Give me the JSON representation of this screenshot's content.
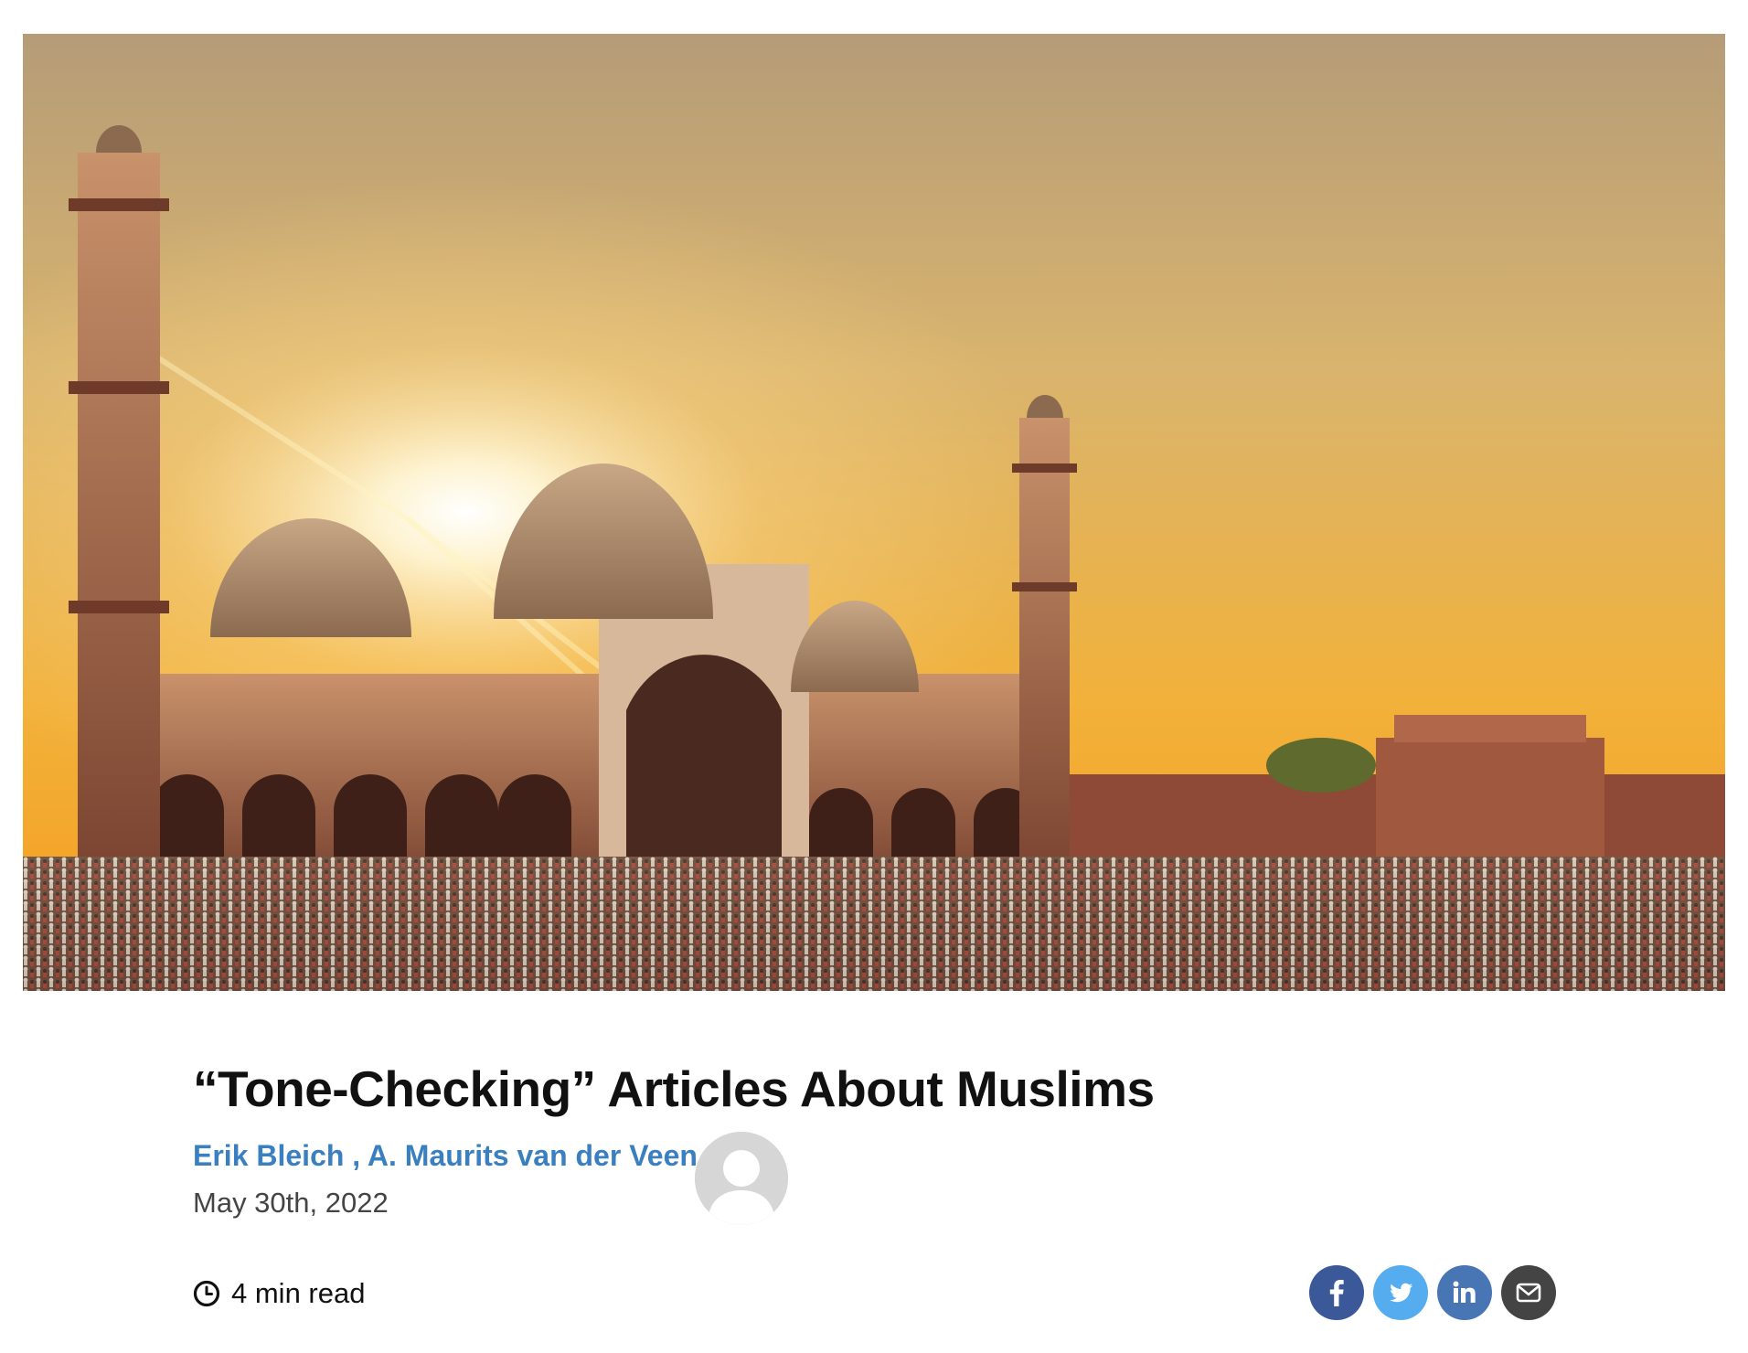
{
  "hero": {
    "alt": "Jama Masjid mosque at sunset with large crowd"
  },
  "article": {
    "title": "“Tone-Checking” Articles About Muslims",
    "authors": [
      "Erik Bleich",
      "A. Maurits van der Veen"
    ],
    "author_separator": " , ",
    "date": "May 30th, 2022",
    "read_time": "4 min read"
  },
  "share": [
    {
      "name": "facebook",
      "icon": "facebook-icon",
      "color": "#3b5998"
    },
    {
      "name": "twitter",
      "icon": "twitter-icon",
      "color": "#55acee"
    },
    {
      "name": "linkedin",
      "icon": "linkedin-icon",
      "color": "#4875b4"
    },
    {
      "name": "email",
      "icon": "envelope-icon",
      "color": "#444444"
    }
  ],
  "colors": {
    "author_link": "#3a7fc0",
    "title": "#111111",
    "date": "#444444"
  }
}
